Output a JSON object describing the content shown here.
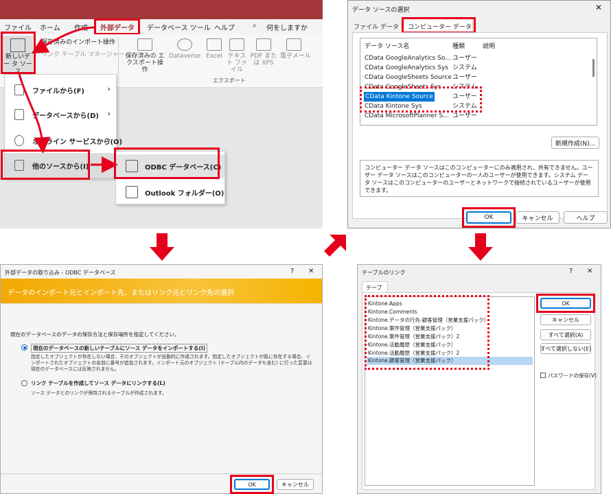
{
  "panel1": {
    "tabs": [
      "ファイル",
      "ホーム",
      "作成",
      "外部データ",
      "データベース ツール",
      "ヘルプ"
    ],
    "search_label": "何をしますか",
    "new_source_label": "新しいデー タ ソース",
    "saved_imports": "保存済みのインポート操作",
    "linked_table_manager": "リンク テーブル マネージャー",
    "export_group": {
      "buttons": [
        "保存済みの エクスポート操作",
        "Dataverse",
        "Excel",
        "テキスト ファイル",
        "PDF または XPS",
        "電子メール"
      ],
      "group_label": "エクスポート"
    },
    "menu": [
      "ファイルから(F)",
      "データベースから(D)",
      "オンライン サービスから(O)",
      "他のソースから(I)"
    ],
    "submenu": [
      "ODBC データベース(C)",
      "Outlook フォルダー(O)"
    ]
  },
  "panel2": {
    "title": "データ ソースの選択",
    "tabs": [
      "ファイル データ ソース",
      "コンピューター データ ソース"
    ],
    "columns": [
      "データ ソース名",
      "種類",
      "説明"
    ],
    "rows": [
      {
        "name": "CData GoogleAnalytics So...",
        "type": "ユーザー"
      },
      {
        "name": "CData GoogleAnalytics Sys",
        "type": "システム"
      },
      {
        "name": "CData GoogleSheets Source",
        "type": "ユーザー"
      },
      {
        "name": "CData GoogleSheets Sys",
        "type": "システム"
      },
      {
        "name": "CData Kintone Source",
        "type": "ユーザー"
      },
      {
        "name": "CData Kintone Sys",
        "type": "システム"
      },
      {
        "name": "CData MicrosoftPlanner S...",
        "type": "ユーザー"
      }
    ],
    "new_button": "新規作成(N)...",
    "description": "コンピューター データ ソースはこのコンピューターにのみ適用され、共有できません。ユーザー データ ソースはこのコンピューターの一人のユーザーが使用できます。システム データ ソースはこのコンピューターのユーザーとネットワークで接続されているユーザーが使用できます。",
    "ok": "OK",
    "cancel": "キャンセル",
    "help": "ヘルプ"
  },
  "panel3": {
    "title": "外部データの取り込み - ODBC データベース",
    "help_btn": "?",
    "close_btn": "✕",
    "header": "データのインポート元とインポート先、またはリンク元とリンク先の選択",
    "intro": "現在のデータベースのデータの保存方法と保存場所を指定してください。",
    "option1_label": "現在のデータベースの新しいテーブルにソース データをインポートする(I)",
    "option1_desc": "指定したオブジェクトが存在しない場合、そのオブジェクトが自動的に作成されます。指定したオブジェクトが既に存在する場合、インポートされたオブジェクトの名前に番号が追加されます。インポート元のオブジェクト (テーブル内のデータも含む) に行った変更は現在のデータベースには反映されません。",
    "option2_label": "リンク テーブルを作成してソース データにリンクする(L)",
    "option2_desc": "ソース データとのリンクが保持されるテーブルが作成されます。",
    "ok": "OK",
    "cancel": "キャンセル"
  },
  "panel4": {
    "title": "テーブルのリンク",
    "help_btn": "?",
    "close_btn": "✕",
    "tab": "テーブル",
    "items": [
      "Kintone.Apps",
      "Kintone.Comments",
      "Kintone.データの行先-顧客管理（営業支援パック）",
      "Kintone.案件管理（営業支援パック）",
      "Kintone.案件管理（営業支援パック）2",
      "Kintone.活動履歴（営業支援パック）",
      "Kintone.活動履歴（営業支援パック）2",
      "Kintone.顧客管理（営業支援パック）"
    ],
    "ok": "OK",
    "cancel": "キャンセル",
    "select_all": "すべて選択(A)",
    "deselect_all": "すべて選択しない(E)",
    "save_password": "パスワードの保存(V)"
  },
  "colors": {
    "highlight": "#e5001c",
    "access_red": "#a4373a",
    "selection": "#0078d7",
    "banner": "#f5b400"
  }
}
